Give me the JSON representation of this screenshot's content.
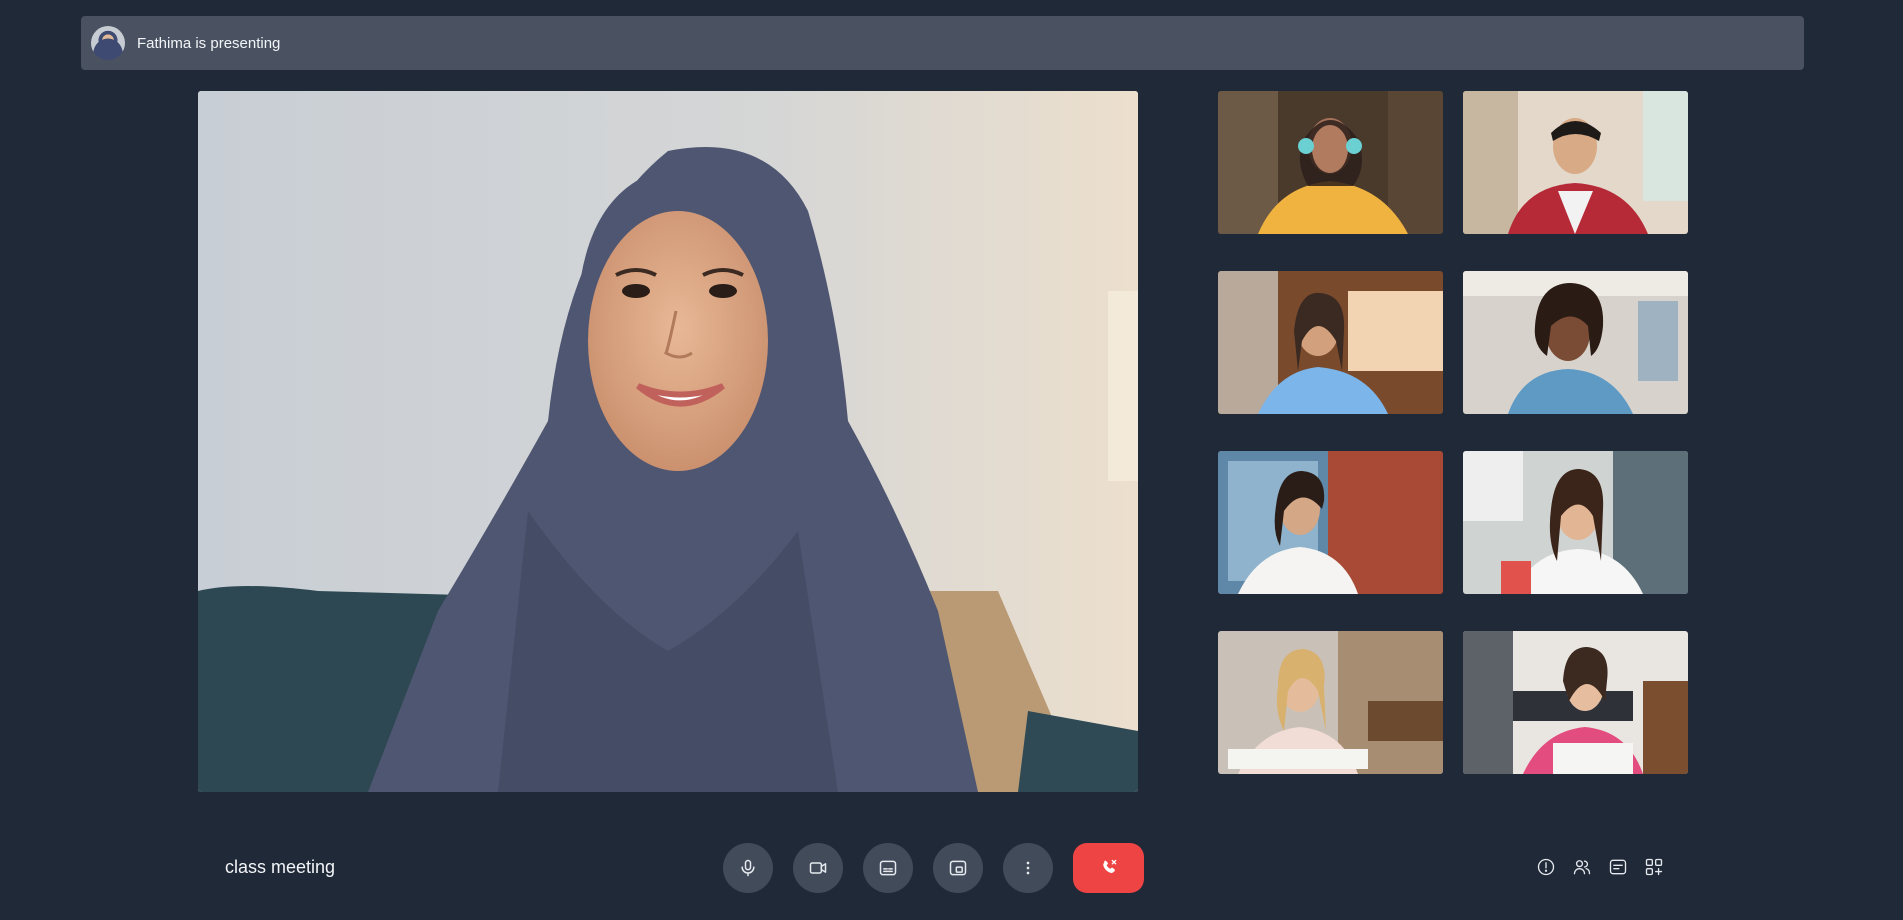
{
  "presenter_banner": {
    "text": "Fathima is presenting"
  },
  "meeting": {
    "title": "class meeting"
  },
  "participants": [
    {
      "id": "p1",
      "icon": "participant-video"
    },
    {
      "id": "p2",
      "icon": "participant-video"
    },
    {
      "id": "p3",
      "icon": "participant-video"
    },
    {
      "id": "p4",
      "icon": "participant-video"
    },
    {
      "id": "p5",
      "icon": "participant-video"
    },
    {
      "id": "p6",
      "icon": "participant-video"
    },
    {
      "id": "p7",
      "icon": "participant-video"
    },
    {
      "id": "p8",
      "icon": "participant-video"
    }
  ],
  "controls": {
    "icons": [
      "microphone-icon",
      "camera-icon",
      "captions-icon",
      "screen-share-icon",
      "more-options-icon",
      "end-call-icon"
    ]
  },
  "right_tools": {
    "icons": [
      "info-icon",
      "people-icon",
      "chat-icon",
      "apps-icon"
    ]
  },
  "colors": {
    "background": "#202938",
    "banner": "#4a5262",
    "control_button": "#414b5a",
    "end_call": "#ef4444"
  }
}
